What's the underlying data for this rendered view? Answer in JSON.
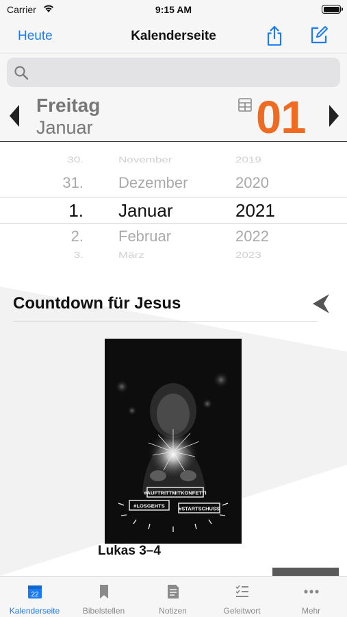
{
  "status_bar": {
    "carrier": "Carrier",
    "time": "9:15 AM"
  },
  "nav": {
    "left_button": "Heute",
    "title": "Kalenderseite",
    "share_icon": "share-icon",
    "compose_icon": "compose-icon"
  },
  "search": {
    "placeholder": "",
    "icon": "search-icon"
  },
  "date_header": {
    "weekday": "Freitag",
    "month": "Januar",
    "day": "01",
    "day_color": "#ef6b21"
  },
  "picker": {
    "rows": [
      {
        "day": "30.",
        "month": "November",
        "year": "2019"
      },
      {
        "day": "31.",
        "month": "Dezember",
        "year": "2020"
      },
      {
        "day": "1.",
        "month": "Januar",
        "year": "2021"
      },
      {
        "day": "2.",
        "month": "Februar",
        "year": "2022"
      },
      {
        "day": "3.",
        "month": "März",
        "year": "2023"
      }
    ]
  },
  "content": {
    "heading": "Countdown für Jesus",
    "photo_tags": [
      "#AUFTRITTMITKONFETTI",
      "#LOSGEHTS",
      "#STARTSCHUSS"
    ],
    "caption": "Lukas 3–4"
  },
  "tabs": [
    {
      "label": "Kalenderseite",
      "icon": "calendar-icon",
      "badge": "22",
      "active": true
    },
    {
      "label": "Bibelstellen",
      "icon": "bookmark-icon",
      "active": false
    },
    {
      "label": "Notizen",
      "icon": "notes-icon",
      "active": false
    },
    {
      "label": "Geleitwort",
      "icon": "checklist-icon",
      "active": false
    },
    {
      "label": "Mehr",
      "icon": "more-icon",
      "active": false
    }
  ],
  "colors": {
    "accent": "#1a7cf5",
    "date_orange": "#ef6b21"
  }
}
